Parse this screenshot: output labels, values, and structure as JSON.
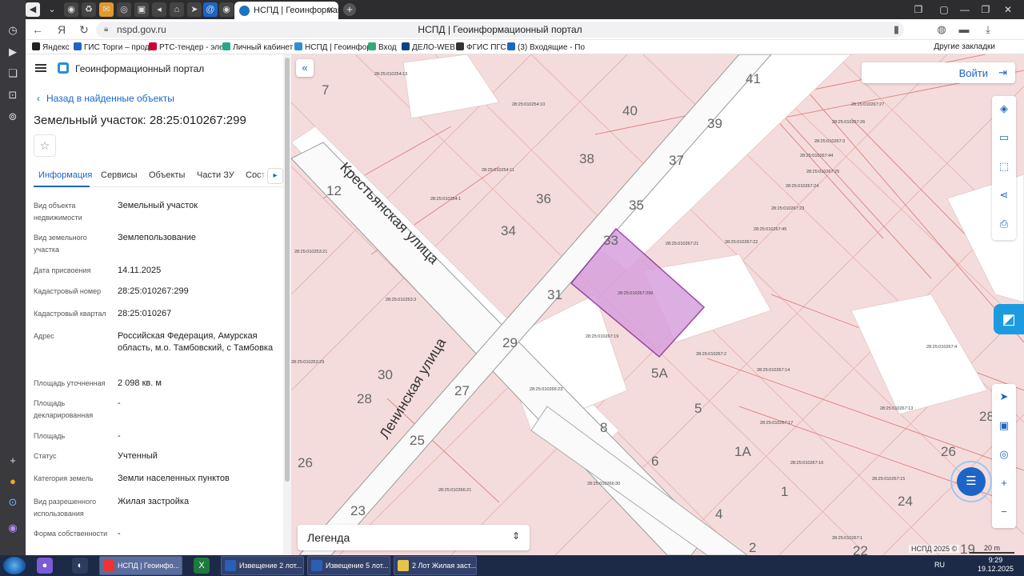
{
  "browser": {
    "active_tab_title": "НСПД | Геоинформаци",
    "url": "nspd.gov.ru",
    "page_title": "НСПД | Геоинформационный портал",
    "bookmarks": [
      "Яндекс",
      "ГИС Торги – прод",
      "РТС-тендер - эле",
      "Личный кабинет",
      "НСПД | Геоинфор",
      "Вход",
      "ДЕЛО-WEB",
      "ФГИС ПГС",
      "(3) Входящие - По"
    ],
    "other_bookmarks": "Другие закладки"
  },
  "panel": {
    "portal_name": "Геоинформационный портал",
    "back_link": "Назад в найденные объекты",
    "title": "Земельный участок: 28:25:010267:299",
    "favorite_icon": "star-icon",
    "tabs": [
      "Информация",
      "Сервисы",
      "Объекты",
      "Части ЗУ",
      "Состав"
    ],
    "fields": [
      {
        "label": "Вид объекта недвижимости",
        "value": "Земельный участок"
      },
      {
        "label": "Вид земельного участка",
        "value": "Землепользование"
      },
      {
        "label": "Дата присвоения",
        "value": "14.11.2025"
      },
      {
        "label": "Кадастровый номер",
        "value": "28:25:010267:299"
      },
      {
        "label": "Кадастровый квартал",
        "value": "28:25:010267"
      },
      {
        "label": "Адрес",
        "value": "Российская Федерация, Амурская область, м.о. Тамбовский, с Тамбовка"
      },
      {
        "label": "Площадь уточненная",
        "value": "2 098 кв. м"
      },
      {
        "label": "Площадь декларированная",
        "value": "-"
      },
      {
        "label": "Площадь",
        "value": "-"
      },
      {
        "label": "Статус",
        "value": "Учтенный"
      },
      {
        "label": "Категория земель",
        "value": "Земли населенных пунктов"
      },
      {
        "label": "Вид разрешенного использования",
        "value": "Жилая застройка"
      },
      {
        "label": "Форма собственности",
        "value": "-"
      }
    ]
  },
  "map": {
    "login": "Войти",
    "legend": "Легенда",
    "copyright": "НСПД 2025 ©",
    "scale": "20 m",
    "streets": [
      "Крестьянская улица",
      "Ленинская улица"
    ],
    "house_numbers": [
      "41",
      "40",
      "39",
      "7",
      "38",
      "37",
      "36",
      "35",
      "34",
      "33",
      "12",
      "31",
      "29",
      "30",
      "28",
      "27",
      "25",
      "26",
      "5А",
      "5",
      "8",
      "6",
      "1А",
      "4",
      "1",
      "2",
      "23",
      "24",
      "26",
      "28",
      "19",
      "22"
    ],
    "parcel_labels": [
      "28:25:010254:13",
      "28:25:010254:10",
      "28:25:010267:27",
      "28:25:010267:26",
      "28:25:010267:3",
      "28:25:010267:44",
      "28:25:010267:25",
      "28:25:010267:24",
      "28:25:010267:23",
      "28:25:010267:45",
      "28:25:010254:11",
      "28:25:010254:1",
      "28:25:010267:21",
      "28:25:010267:22",
      "28:25:010253:21",
      "28:25:010267:299",
      "28:25:010253:3",
      "28:25:010267:19",
      "28:25:010267:2",
      "28:25:010267:4",
      "28:25:010267:14",
      "28:25:010266:23",
      "28:25:010267:13",
      "28:25:010267:17",
      "28:25:010267:16",
      "28:25:010267:15",
      "28:25:010266:21",
      "28:25:010266:30",
      "28:25:010267:1",
      "28:25:010253:29"
    ],
    "selected_parcel_color": "#d7a1dc"
  },
  "taskbar": {
    "tasks": [
      "НСПД | Геоинфо...",
      "Извещение 2 лот...",
      "Извещение 5 лот...",
      "2 Лот Жилая заст..."
    ],
    "lang": "RU",
    "time": "9:29",
    "date": "19.12.2025"
  }
}
